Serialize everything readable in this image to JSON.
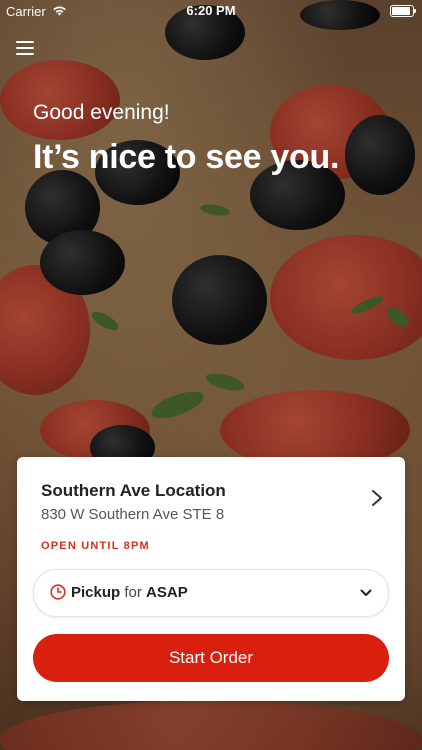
{
  "status_bar": {
    "carrier": "Carrier",
    "time": "6:20 PM",
    "battery_level": 1.0
  },
  "header": {
    "greeting": "Good evening!",
    "headline": "It’s nice to see you."
  },
  "location_card": {
    "name": "Southern Ave Location",
    "address": "830 W Southern Ave STE 8",
    "hours_status": "OPEN UNTIL 8PM"
  },
  "order_mode": {
    "mode": "Pickup",
    "connector": "for",
    "time": "ASAP"
  },
  "actions": {
    "start_order_label": "Start Order"
  },
  "colors": {
    "accent": "#d9200e",
    "hours_status": "#d4301f",
    "card_bg": "#ffffff"
  }
}
